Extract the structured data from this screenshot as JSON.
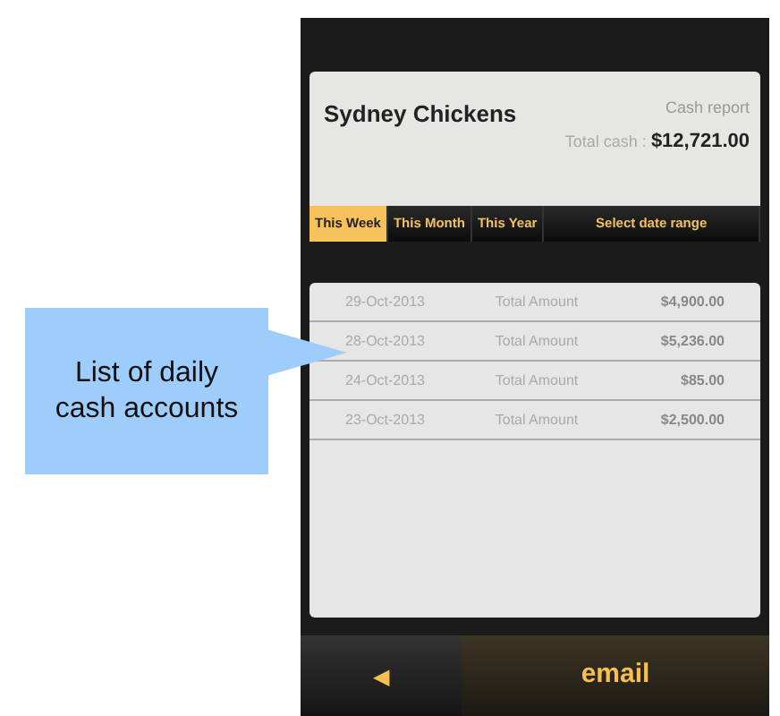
{
  "callout": {
    "text": "List of daily cash accounts"
  },
  "header": {
    "title": "Sydney Chickens",
    "report_label": "Cash report",
    "total_label": "Total cash :",
    "total_value": "$12,721.00"
  },
  "tabs": [
    {
      "label": "This Week",
      "selected": true
    },
    {
      "label": "This Month",
      "selected": false
    },
    {
      "label": "This Year",
      "selected": false
    },
    {
      "label": "Select date range",
      "selected": false
    }
  ],
  "rows": [
    {
      "date": "29-Oct-2013",
      "label": "Total Amount",
      "amount": "$4,900.00"
    },
    {
      "date": "28-Oct-2013",
      "label": "Total Amount",
      "amount": "$5,236.00"
    },
    {
      "date": "24-Oct-2013",
      "label": "Total Amount",
      "amount": "$85.00"
    },
    {
      "date": "23-Oct-2013",
      "label": "Total Amount",
      "amount": "$2,500.00"
    }
  ],
  "bottom_bar": {
    "back": "◀",
    "email": "email"
  }
}
